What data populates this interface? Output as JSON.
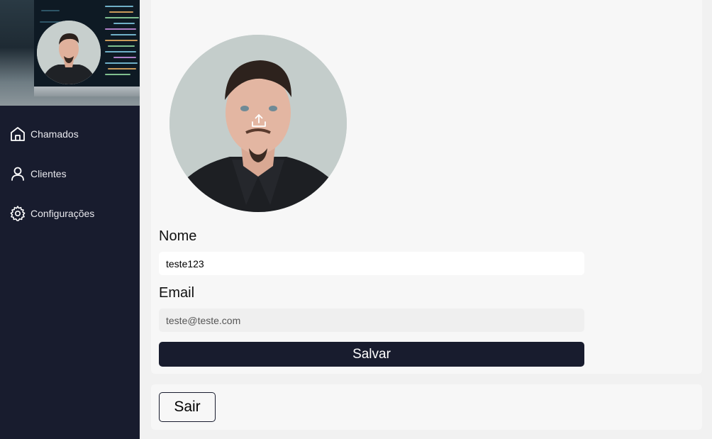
{
  "sidebar": {
    "items": [
      {
        "label": "Chamados",
        "icon": "home-icon"
      },
      {
        "label": "Clientes",
        "icon": "user-icon"
      },
      {
        "label": "Configurações",
        "icon": "gear-icon"
      }
    ]
  },
  "profile": {
    "name_label": "Nome",
    "name_value": "teste123",
    "email_label": "Email",
    "email_value": "teste@teste.com",
    "save_label": "Salvar",
    "avatar_upload_icon": "upload-icon"
  },
  "logout": {
    "label": "Sair"
  },
  "colors": {
    "sidebar_bg": "#181c2e",
    "panel_bg": "#f7f7f7",
    "page_bg": "#f1f1f1"
  }
}
